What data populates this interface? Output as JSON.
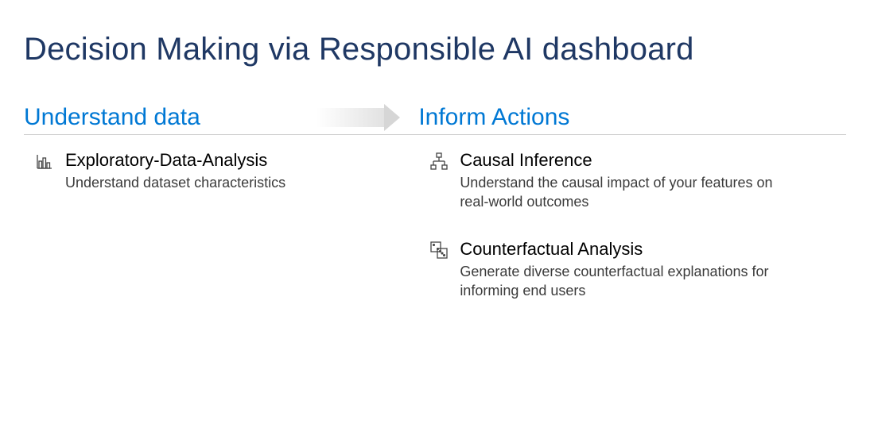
{
  "title": "Decision Making via Responsible AI dashboard",
  "columns": {
    "left": {
      "heading": "Understand data",
      "items": [
        {
          "icon": "bar-chart-icon",
          "title": "Exploratory-Data-Analysis",
          "desc": "Understand dataset characteristics"
        }
      ]
    },
    "right": {
      "heading": "Inform Actions",
      "items": [
        {
          "icon": "hierarchy-icon",
          "title": "Causal Inference",
          "desc": "Understand the causal impact of your features on real-world outcomes"
        },
        {
          "icon": "dice-icon",
          "title": "Counterfactual Analysis",
          "desc": "Generate diverse counterfactual explanations for informing end users"
        }
      ]
    }
  }
}
